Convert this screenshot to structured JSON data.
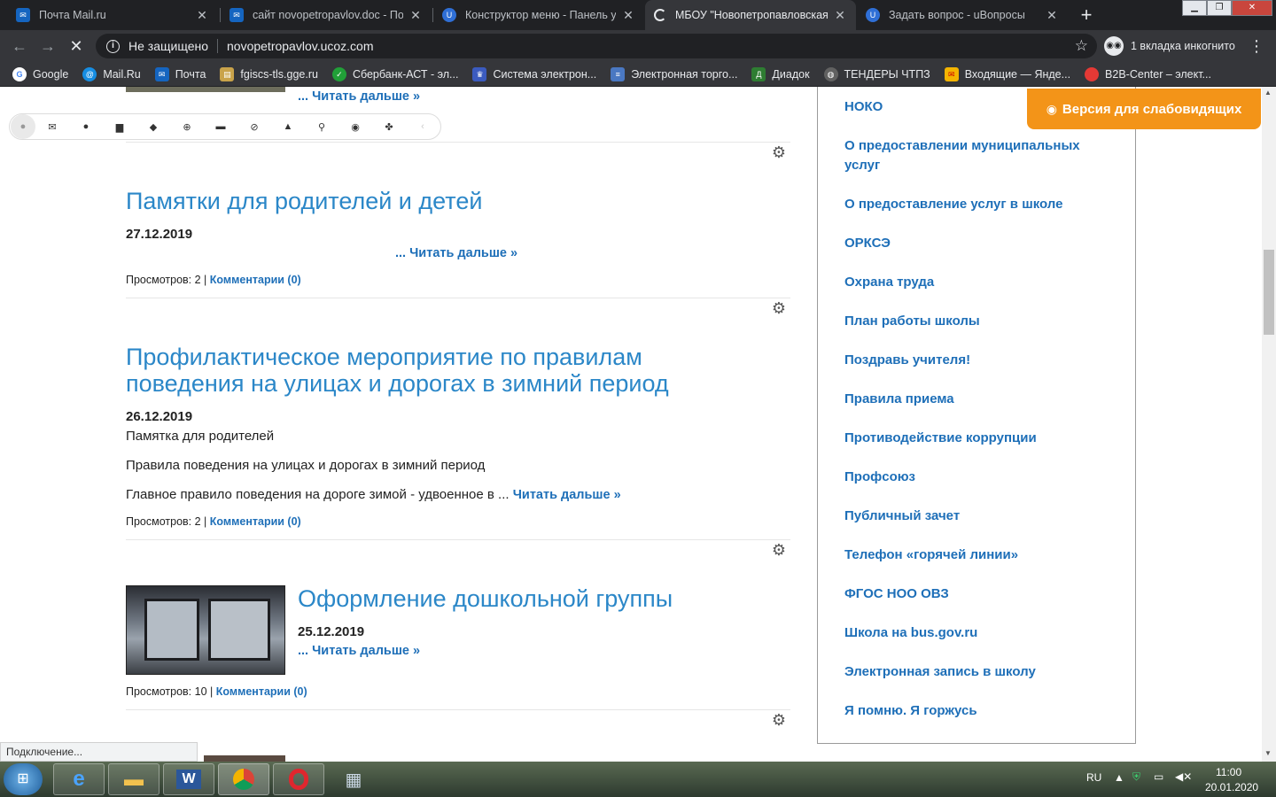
{
  "browser": {
    "tabs": [
      {
        "label": "Почта Mail.ru",
        "icon": "mail-icon",
        "color": "#1565c0"
      },
      {
        "label": "сайт novopetropavlov.doc - Почт",
        "icon": "mail-icon",
        "color": "#1565c0"
      },
      {
        "label": "Конструктор меню - Панель упр",
        "icon": "ucoz-icon",
        "color": "#2f6fd6"
      },
      {
        "label": "МБОУ \"Новопетропавловская С",
        "icon": "loading-icon",
        "color": "#e8eaed"
      },
      {
        "label": "Задать вопрос - uВопросы",
        "icon": "ucoz-icon",
        "color": "#2f6fd6"
      }
    ],
    "url_security": "Не защищено",
    "url": "novopetropavlov.ucoz.com",
    "incognito": "1 вкладка инкогнито",
    "bookmarks": [
      {
        "label": "Google",
        "color": "#4285f4"
      },
      {
        "label": "Mail.Ru",
        "color": "#168de2"
      },
      {
        "label": "Почта",
        "color": "#1565c0"
      },
      {
        "label": "fgiscs-tls.gge.ru",
        "color": "#c9a34a"
      },
      {
        "label": "Сбербанк-АСТ - эл...",
        "color": "#21a038"
      },
      {
        "label": "Система электрон...",
        "color": "#3b5bbf"
      },
      {
        "label": "Электронная торго...",
        "color": "#4a78c2"
      },
      {
        "label": "Диадок",
        "color": "#2e7d32"
      },
      {
        "label": "ТЕНДЕРЫ ЧТПЗ",
        "color": "#616161"
      },
      {
        "label": "Входящие — Янде...",
        "color": "#f4b400"
      },
      {
        "label": "B2B-Center – элект...",
        "color": "#e53935"
      }
    ]
  },
  "page": {
    "top_more": "... Читать дальше »",
    "posts": [
      {
        "title": "Памятки для родителей и детей",
        "date": "27.12.2019",
        "more": "... Читать дальше »",
        "views": "Просмотров: 2 |",
        "comments": "Комментарии (0)"
      },
      {
        "title_line1": "Профилактическое мероприятие по правилам",
        "title_line2": "поведения на улицах и дорогах в зимний период",
        "date": "26.12.2019",
        "line1": "Памятка для родителей",
        "line2": "Правила поведения на улицах и дорогах в зимний период",
        "line3": "Главное правило поведения на дороге зимой - удвоенное в ...",
        "more": "Читать дальше »",
        "views": "Просмотров: 2 |",
        "comments": "Комментарии (0)"
      },
      {
        "title": "Оформление дошкольной группы",
        "date": "25.12.2019",
        "more": "... Читать дальше »",
        "views": "Просмотров: 10 |",
        "comments": "Комментарии (0)"
      }
    ],
    "sidebar_items": [
      "НОКО",
      "О предоставлении муниципальных",
      "услуг",
      "О предоставление услуг в школе",
      "ОРКСЭ",
      "Охрана труда",
      "План работы школы",
      "Поздравь учителя!",
      "Правила приема",
      "Противодействие коррупции",
      "Профсоюз",
      "Публичный зачет",
      "Телефон «горячей линии»",
      "ФГОС НОО ОВЗ",
      "Школа на bus.gov.ru",
      "Электронная запись в школу",
      "Я помню. Я горжусь"
    ],
    "vision_button": "Версия для слабовидящих",
    "status": "Подключение..."
  },
  "taskbar": {
    "lang": "RU",
    "time": "11:00",
    "date": "20.01.2020"
  }
}
